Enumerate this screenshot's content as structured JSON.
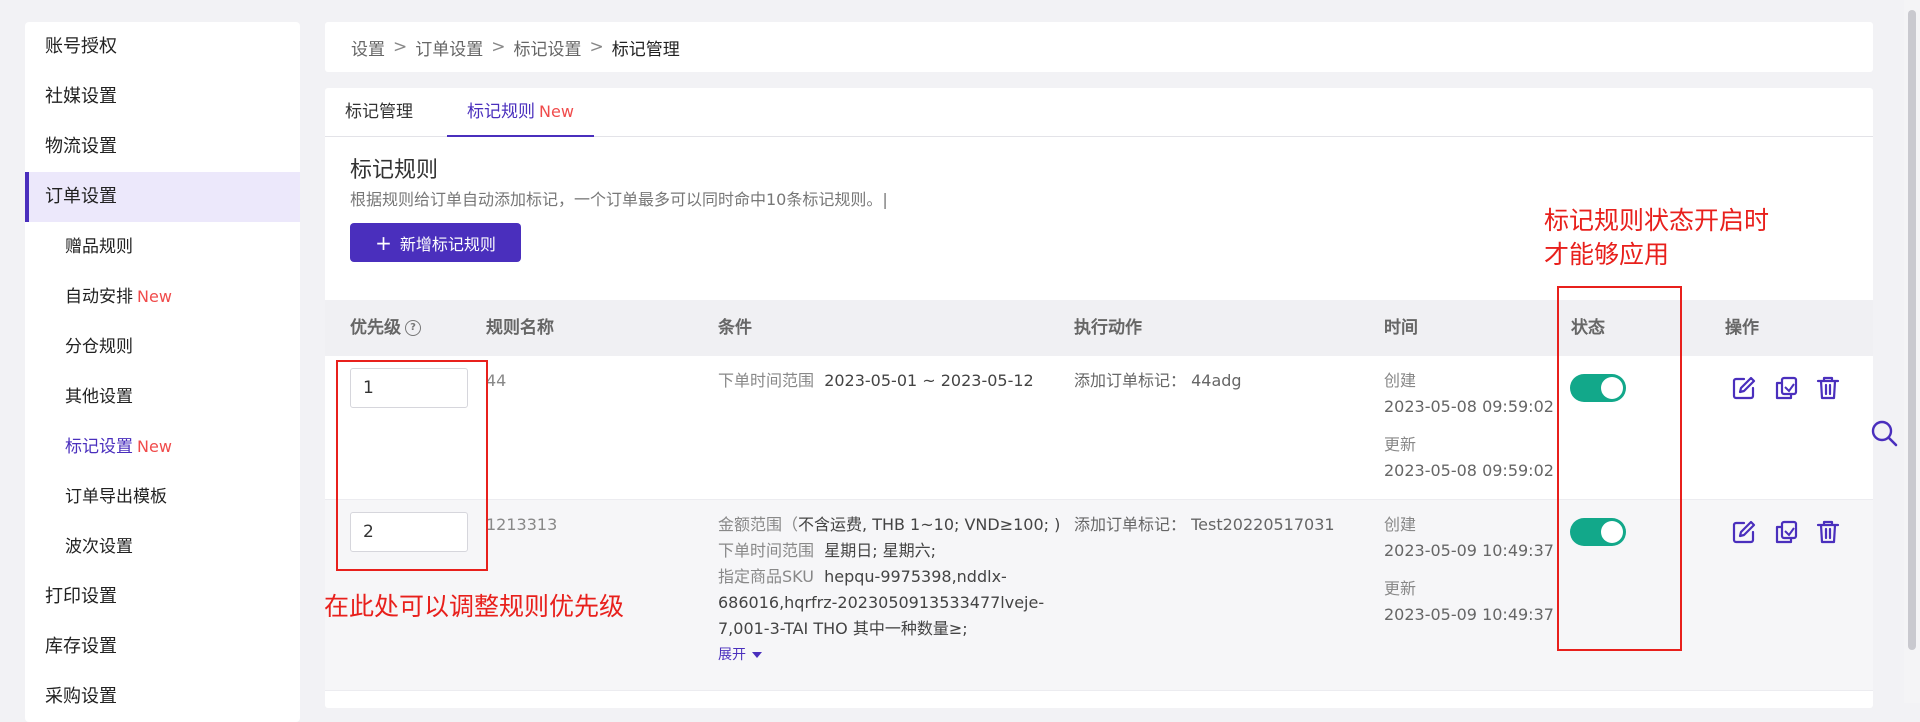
{
  "sidebar": {
    "items": [
      {
        "label": "账号授权"
      },
      {
        "label": "社媒设置"
      },
      {
        "label": "物流设置"
      },
      {
        "label": "订单设置"
      },
      {
        "label": "赠品规则"
      },
      {
        "label": "自动安排",
        "badge": "New"
      },
      {
        "label": "分仓规则"
      },
      {
        "label": "其他设置"
      },
      {
        "label": "标记设置",
        "badge": "New"
      },
      {
        "label": "订单导出模板"
      },
      {
        "label": "波次设置"
      },
      {
        "label": "打印设置"
      },
      {
        "label": "库存设置"
      },
      {
        "label": "采购设置"
      }
    ]
  },
  "breadcrumb": {
    "items": [
      "设置",
      "订单设置",
      "标记设置"
    ],
    "separator": ">",
    "current": "标记管理"
  },
  "tabs": [
    {
      "label": "标记管理"
    },
    {
      "label": "标记规则",
      "badge": "New"
    }
  ],
  "section": {
    "title": "标记规则",
    "description": "根据规则给订单自动添加标记，一个订单最多可以同时命中10条标记规则。|",
    "add_button": "新增标记规则"
  },
  "table": {
    "headers": {
      "priority": "优先级",
      "name": "规则名称",
      "condition": "条件",
      "action": "执行动作",
      "time": "时间",
      "status": "状态",
      "ops": "操作"
    },
    "rows": [
      {
        "priority": "1",
        "name": "44",
        "conditions": [
          {
            "label": "下单时间范围",
            "value": "2023-05-01 ~ 2023-05-12"
          }
        ],
        "action": "添加订单标记：  44adg",
        "created_label": "创建",
        "created": "2023-05-08 09:59:02",
        "updated_label": "更新",
        "updated": "2023-05-08 09:59:02",
        "enabled": true
      },
      {
        "priority": "2",
        "name": "1213313",
        "conditions": [
          {
            "label": "金额范围（",
            "value": "不含运费, THB 1~10;  VND≥100; )"
          },
          {
            "label": "下单时间范围",
            "value": "星期日; 星期六;"
          },
          {
            "label": "指定商品SKU",
            "value": "hepqu-9975398,nddlx-"
          },
          {
            "label": "",
            "value": "686016,hqrfrz-2023050913533477lveje-"
          },
          {
            "label": "",
            "value": "7,001-3-TAI THO 其中一种数量≥;"
          }
        ],
        "expand": "展开",
        "action": "添加订单标记：  Test20220517031",
        "created_label": "创建",
        "created": "2023-05-09 10:49:37",
        "updated_label": "更新",
        "updated": "2023-05-09 10:49:37",
        "enabled": true
      }
    ]
  },
  "annotations": {
    "status_note_line1": "标记规则状态开启时",
    "status_note_line2": "才能够应用",
    "priority_note": "在此处可以调整规则优先级"
  },
  "colors": {
    "accent": "#4a2fbd",
    "toggle_on": "#12a88a",
    "annotation": "#e8201c",
    "new_badge": "#f04b4b"
  },
  "icons": [
    "help-icon",
    "edit-icon",
    "copy-icon",
    "delete-icon",
    "search-icon",
    "plus-icon",
    "caret-down-icon"
  ]
}
